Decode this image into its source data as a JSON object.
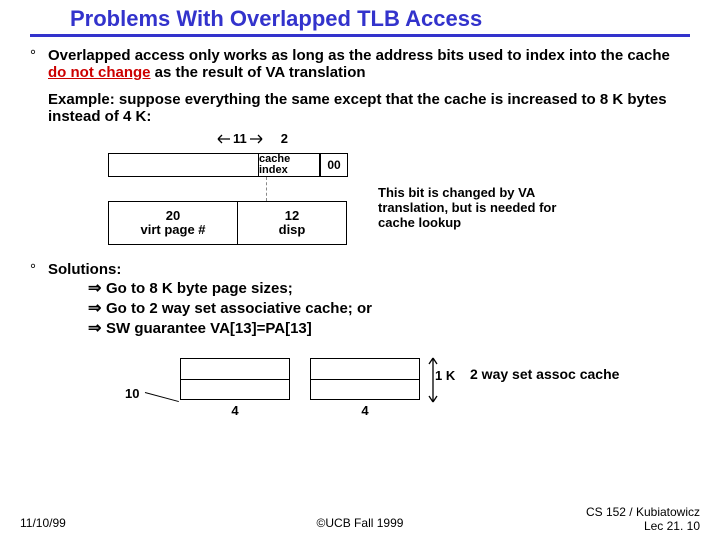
{
  "title": "Problems With Overlapped TLB Access",
  "bullet1_a": "Overlapped access only works as long as the address bits used to index into the cache ",
  "bullet1_b": "do not change",
  "bullet1_c": "  as the result of VA translation",
  "example": "Example:  suppose everything the same except that the cache is increased to 8 K bytes instead of 4 K:",
  "d1": {
    "top_11": "11",
    "top_2": "2",
    "cache_index": "cache index",
    "zeros": "00",
    "vp_num": "20",
    "vp_label": "virt page #",
    "disp_num": "12",
    "disp_label": "disp",
    "note": "This bit is changed by VA translation, but is needed for cache lookup"
  },
  "solutions": {
    "head": "Solutions:",
    "s1": "Go to 8 K byte page sizes;",
    "s2": "Go to 2 way set associative cache; or",
    "s3": "SW guarantee VA[13]=PA[13]"
  },
  "d2": {
    "ten": "10",
    "four": "4",
    "onek": "1 K",
    "assoc": "2 way set assoc cache"
  },
  "footer": {
    "date": "11/10/99",
    "center": "©UCB Fall 1999",
    "right1": "CS 152 / Kubiatowicz",
    "right2": "Lec 21. 10"
  }
}
